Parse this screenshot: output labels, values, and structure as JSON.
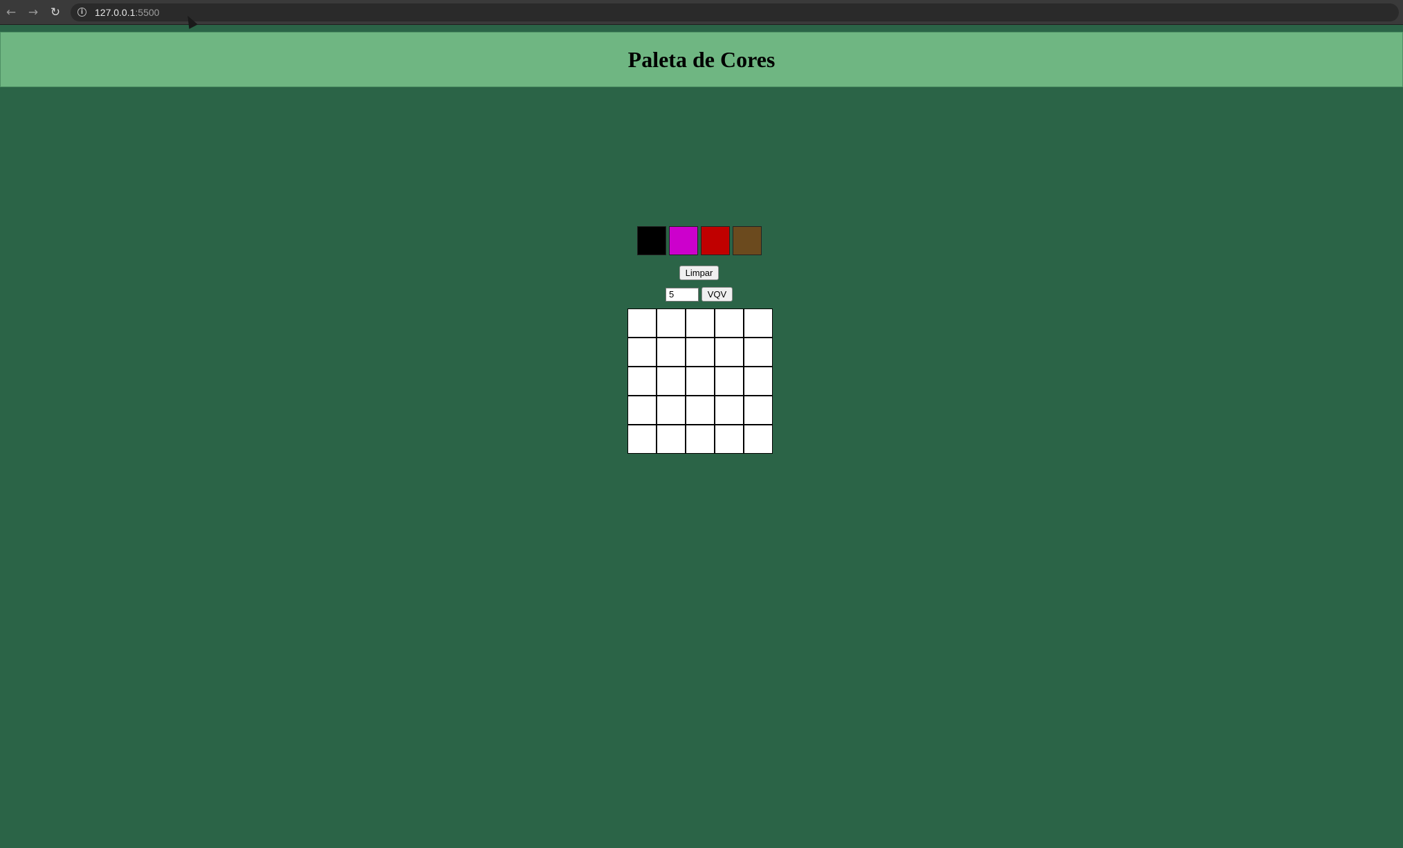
{
  "browser": {
    "url_host": "127.0.0.1",
    "url_port": ":5500",
    "back_glyph": "←",
    "forward_glyph": "→",
    "reload_glyph": "↻",
    "info_glyph": "i"
  },
  "header": {
    "title": "Paleta de Cores"
  },
  "palette": {
    "colors": [
      "#000000",
      "#cc00cc",
      "#c00000",
      "#6b4a1e"
    ]
  },
  "controls": {
    "clear_label": "Limpar",
    "size_value": "5",
    "vqv_label": "VQV"
  },
  "board": {
    "rows": 5,
    "cols": 5,
    "cell_color": "#ffffff"
  }
}
